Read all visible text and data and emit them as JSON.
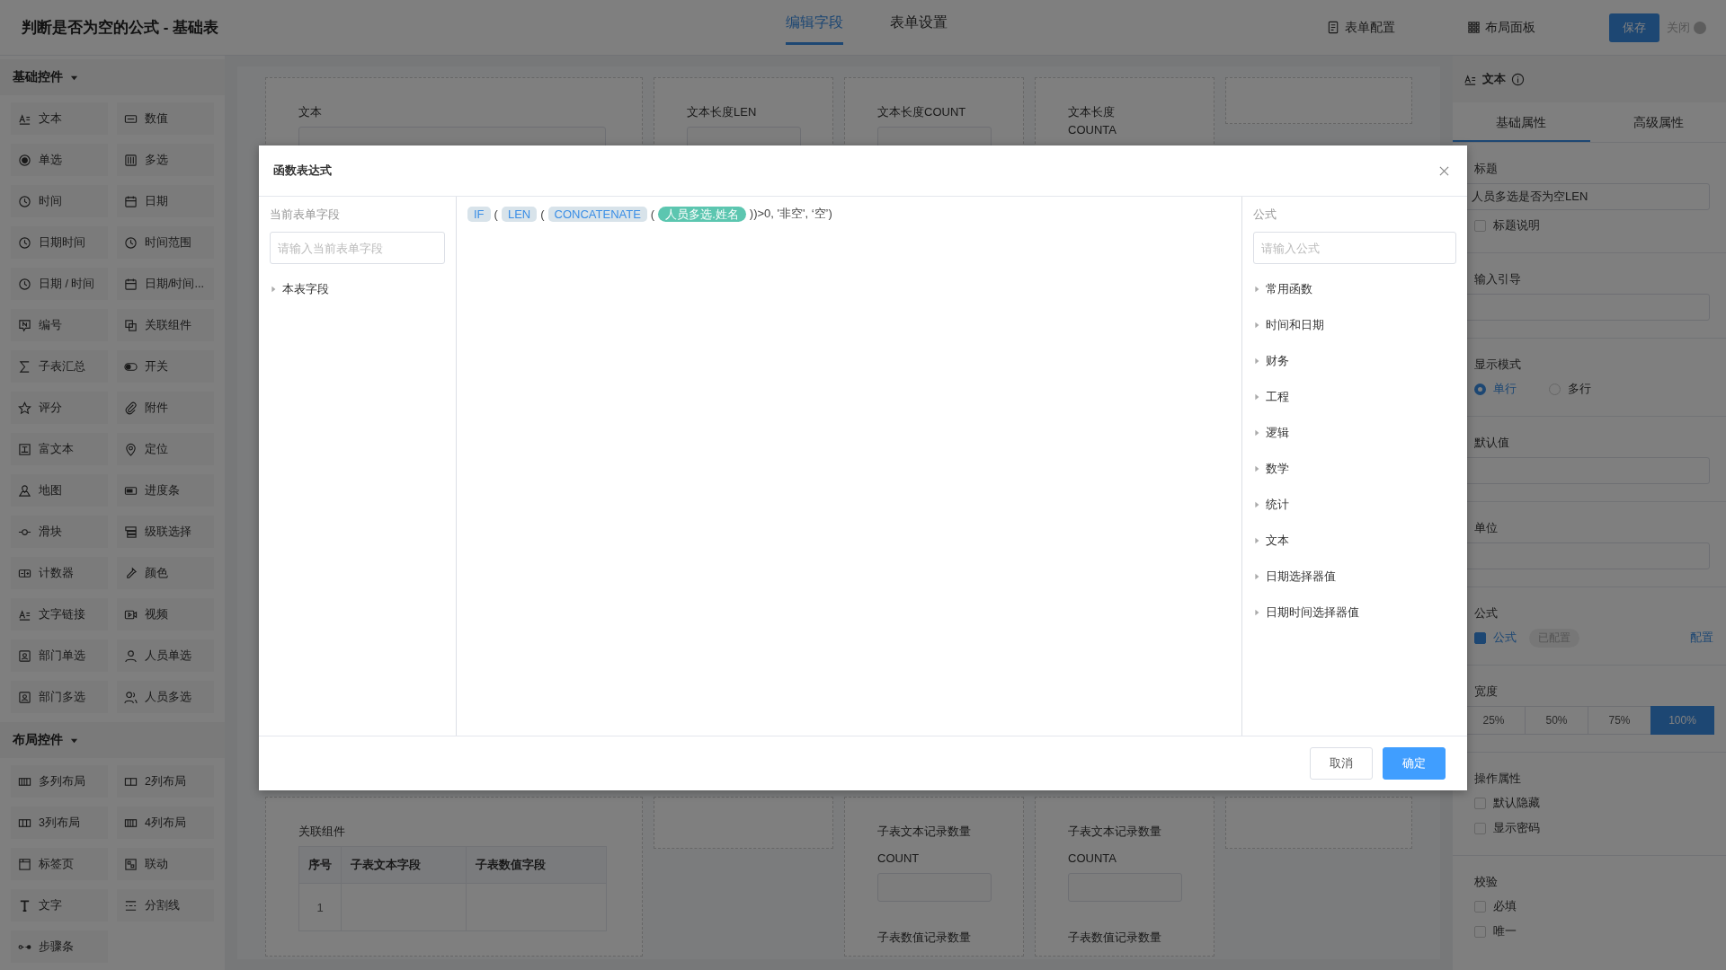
{
  "topbar": {
    "title": "判断是否为空的公式 - 基础表",
    "tabs": [
      {
        "label": "编辑字段",
        "selected": true
      },
      {
        "label": "表单设置",
        "selected": false
      }
    ],
    "actions": [
      {
        "label": "表单配置",
        "kind": "form"
      },
      {
        "label": "布局面板",
        "kind": "grid"
      }
    ],
    "save_button": "保存",
    "close": {
      "label": "关闭",
      "on": false
    }
  },
  "sidebar": {
    "groups": [
      {
        "title": "基础控件",
        "expanded": true,
        "items": [
          {
            "label": "文本",
            "kind": "text"
          },
          {
            "label": "数值",
            "kind": "number"
          },
          {
            "label": "单选",
            "kind": "radio"
          },
          {
            "label": "多选",
            "kind": "checkbox"
          },
          {
            "label": "时间",
            "kind": "clock"
          },
          {
            "label": "日期",
            "kind": "calendar"
          },
          {
            "label": "日期时间",
            "kind": "clock"
          },
          {
            "label": "时间范围",
            "kind": "clock"
          },
          {
            "label": "日期 / 时间",
            "kind": "clock"
          },
          {
            "label": "日期/时间...",
            "kind": "calendar"
          },
          {
            "label": "编号",
            "kind": "serial"
          },
          {
            "label": "关联组件",
            "kind": "link"
          },
          {
            "label": "子表汇总",
            "kind": "sigma"
          },
          {
            "label": "开关",
            "kind": "switch"
          },
          {
            "label": "评分",
            "kind": "star"
          },
          {
            "label": "附件",
            "kind": "clip"
          },
          {
            "label": "富文本",
            "kind": "richtext"
          },
          {
            "label": "定位",
            "kind": "pin"
          },
          {
            "label": "地图",
            "kind": "map"
          },
          {
            "label": "进度条",
            "kind": "progress"
          },
          {
            "label": "滑块",
            "kind": "slider"
          },
          {
            "label": "级联选择",
            "kind": "cascade"
          },
          {
            "label": "计数器",
            "kind": "counter"
          },
          {
            "label": "颜色",
            "kind": "dropper"
          },
          {
            "label": "文字链接",
            "kind": "text"
          },
          {
            "label": "视频",
            "kind": "video"
          },
          {
            "label": "部门单选",
            "kind": "dept"
          },
          {
            "label": "人员单选",
            "kind": "user"
          },
          {
            "label": "部门多选",
            "kind": "dept"
          },
          {
            "label": "人员多选",
            "kind": "users"
          }
        ]
      },
      {
        "title": "布局控件",
        "expanded": true,
        "items": [
          {
            "label": "多列布局",
            "kind": "columns"
          },
          {
            "label": "2列布局",
            "kind": "cols2"
          },
          {
            "label": "3列布局",
            "kind": "cols3"
          },
          {
            "label": "4列布局",
            "kind": "columns"
          },
          {
            "label": "标签页",
            "kind": "tabs"
          },
          {
            "label": "联动",
            "kind": "linkage"
          },
          {
            "label": "文字",
            "kind": "letter"
          },
          {
            "label": "分割线",
            "kind": "divider"
          },
          {
            "label": "步骤条",
            "kind": "steps"
          }
        ]
      }
    ]
  },
  "canvas": {
    "top_cards": [
      {
        "kind": "input",
        "label": "文本"
      },
      {
        "kind": "input",
        "label": "文本长度LEN"
      },
      {
        "kind": "input",
        "label": "文本长度COUNT"
      },
      {
        "kind": "label",
        "label": "文本长度COUNTA"
      },
      {
        "kind": "empty"
      }
    ],
    "bottom_cards": [
      {
        "kind": "table",
        "label": "关联组件",
        "columns": [
          "序号",
          "子表文本字段",
          "子表数值字段"
        ],
        "rows": [
          {
            "index": "1"
          }
        ]
      },
      {
        "kind": "empty"
      },
      {
        "kind": "counts",
        "label": "子表文本记录数量",
        "function": "COUNT",
        "second_label": "子表数值记录数量"
      },
      {
        "kind": "counts",
        "label": "子表文本记录数量",
        "function": "COUNTA",
        "second_label": "子表数值记录数量"
      },
      {
        "kind": "empty"
      }
    ]
  },
  "properties": {
    "header": "文本",
    "tabs": [
      {
        "label": "基础属性",
        "selected": true
      },
      {
        "label": "高级属性",
        "selected": false
      }
    ],
    "title": {
      "label": "标题",
      "value": "人员多选是否为空LEN",
      "note": {
        "label": "标题说明",
        "checked": false
      }
    },
    "guide": {
      "label": "输入引导"
    },
    "display_mode": {
      "label": "显示模式",
      "options": [
        {
          "label": "单行",
          "selected": true
        },
        {
          "label": "多行",
          "selected": false
        }
      ]
    },
    "default_value": {
      "label": "默认值"
    },
    "unit": {
      "label": "单位"
    },
    "formula": {
      "label": "公式",
      "checkbox": {
        "label": "公式",
        "checked": true
      },
      "badge": "已配置",
      "link": "配置"
    },
    "width": {
      "label": "宽度",
      "options": [
        {
          "label": "25%",
          "selected": false
        },
        {
          "label": "50%",
          "selected": false
        },
        {
          "label": "75%",
          "selected": false
        },
        {
          "label": "100%",
          "selected": true
        }
      ]
    },
    "operation": {
      "label": "操作属性",
      "options": [
        {
          "label": "默认隐藏",
          "checked": false
        },
        {
          "label": "显示密码",
          "checked": false
        }
      ]
    },
    "validation": {
      "label": "校验",
      "options": [
        {
          "label": "必填",
          "checked": false
        },
        {
          "label": "唯一",
          "checked": false
        }
      ]
    }
  },
  "dialog": {
    "title": "函数表达式",
    "fields_panel": {
      "label": "当前表单字段",
      "placeholder": "请输入当前表单字段",
      "tree": [
        {
          "label": "本表字段",
          "expanded": false
        }
      ]
    },
    "expression": [
      {
        "kind": "function",
        "text": "IF"
      },
      {
        "kind": "text",
        "text": "("
      },
      {
        "kind": "function",
        "text": "LEN"
      },
      {
        "kind": "text",
        "text": "("
      },
      {
        "kind": "function",
        "text": "CONCATENATE"
      },
      {
        "kind": "text",
        "text": "("
      },
      {
        "kind": "field",
        "text": "人员多选.姓名"
      },
      {
        "kind": "text",
        "text": "))>0, '非空', ‘空’)"
      }
    ],
    "functions_panel": {
      "label": "公式",
      "placeholder": "请输入公式",
      "categories": [
        {
          "label": "常用函数",
          "expanded": false
        },
        {
          "label": "时间和日期",
          "expanded": false
        },
        {
          "label": "财务",
          "expanded": false
        },
        {
          "label": "工程",
          "expanded": false
        },
        {
          "label": "逻辑",
          "expanded": false
        },
        {
          "label": "数学",
          "expanded": false
        },
        {
          "label": "统计",
          "expanded": false
        },
        {
          "label": "文本",
          "expanded": false
        },
        {
          "label": "日期选择器值",
          "expanded": false
        },
        {
          "label": "日期时间选择器值",
          "expanded": false
        }
      ]
    },
    "buttons": [
      {
        "label": "取消",
        "kind": "secondary"
      },
      {
        "label": "确定",
        "kind": "primary"
      }
    ]
  }
}
